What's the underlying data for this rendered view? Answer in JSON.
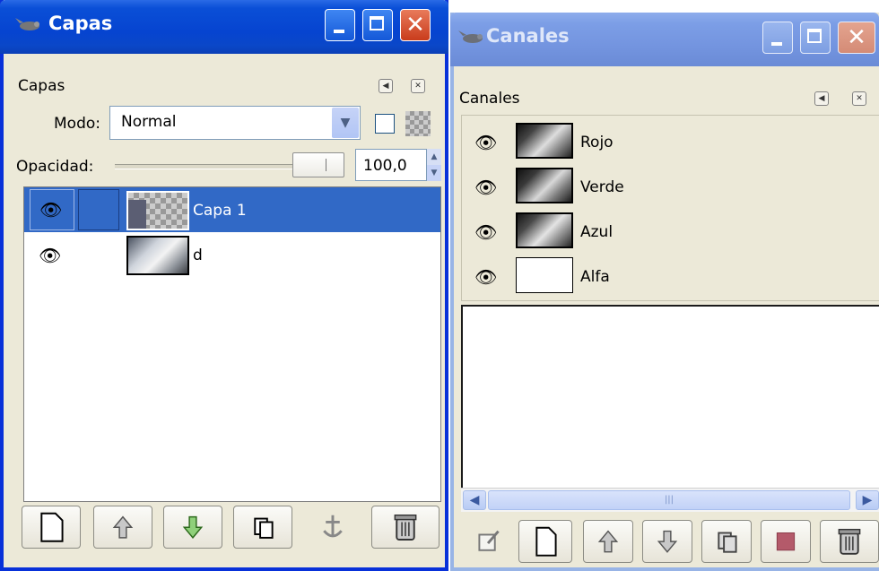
{
  "capas_window": {
    "title": "Capas",
    "panel_title": "Capas",
    "mode_label": "Modo:",
    "mode_value": "Normal",
    "opacity_label": "Opacidad:",
    "opacity_value": "100,0",
    "layers": [
      {
        "name": "Capa 1",
        "selected": true
      },
      {
        "name": "d",
        "selected": false
      }
    ]
  },
  "canales_window": {
    "title": "Canales",
    "panel_title": "Canales",
    "channels": [
      {
        "name": "Rojo"
      },
      {
        "name": "Verde"
      },
      {
        "name": "Azul"
      },
      {
        "name": "Alfa"
      }
    ]
  },
  "colors": {
    "selection": "#3169c6",
    "active_title": "#0a4fd7",
    "inactive_title": "#7c9ee6",
    "panel_bg": "#ece9d8"
  }
}
